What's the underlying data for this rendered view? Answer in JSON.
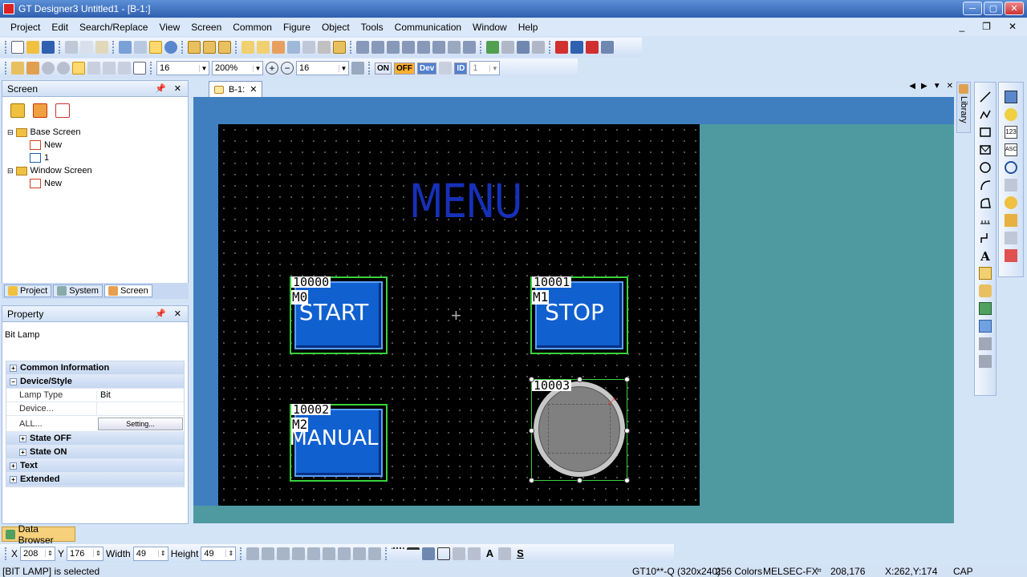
{
  "window": {
    "title": "GT Designer3 Untitled1 - [B-1:]",
    "min": "─",
    "max": "▢",
    "close": "✕"
  },
  "menu": [
    "Project",
    "Edit",
    "Search/Replace",
    "View",
    "Screen",
    "Common",
    "Figure",
    "Object",
    "Tools",
    "Communication",
    "Window",
    "Help"
  ],
  "toolbar2": {
    "grid_value": "16",
    "zoom": "200%",
    "snap_value": "16",
    "on_label": "ON",
    "off_label": "OFF",
    "dev_label": "Dev",
    "id_label": "ID",
    "page_value": "1"
  },
  "screen_panel": {
    "title": "Screen",
    "tree": [
      {
        "label": "Base Screen",
        "level": 0,
        "type": "folder"
      },
      {
        "label": "New",
        "level": 1,
        "type": "new"
      },
      {
        "label": "1",
        "level": 1,
        "type": "screen"
      },
      {
        "label": "Window Screen",
        "level": 0,
        "type": "folder"
      },
      {
        "label": "New",
        "level": 1,
        "type": "new"
      }
    ],
    "tabs": [
      "Project",
      "System",
      "Screen"
    ]
  },
  "property_panel": {
    "title": "Property",
    "object": "Bit Lamp",
    "rows": [
      {
        "label": "Common Information",
        "cat": true,
        "sign": "+"
      },
      {
        "label": "Device/Style",
        "cat": true,
        "sign": "−"
      },
      {
        "label": "Lamp Type",
        "value": "Bit"
      },
      {
        "label": "Device...",
        "value": ""
      },
      {
        "label": "ALL...",
        "button": "Setting..."
      },
      {
        "label": "State OFF",
        "cat": true,
        "sign": "+",
        "sub": true
      },
      {
        "label": "State ON",
        "cat": true,
        "sign": "+",
        "sub": true
      },
      {
        "label": "Text",
        "cat": true,
        "sign": "+"
      },
      {
        "label": "Extended",
        "cat": true,
        "sign": "+"
      }
    ]
  },
  "doc_tab": {
    "label": "B-1:",
    "close": "✕"
  },
  "library_label": "Library",
  "canvas": {
    "title": "MENU",
    "buttons": [
      {
        "id": "10000",
        "device": "M0",
        "label": "START"
      },
      {
        "id": "10001",
        "device": "M1",
        "label": "STOP"
      },
      {
        "id": "10002",
        "device": "M2",
        "label": "MANUAL"
      }
    ],
    "lamp": {
      "id": "10003"
    }
  },
  "data_browser": "Data Browser",
  "coords": {
    "x_label": "X",
    "x": "208",
    "y_label": "Y",
    "y": "176",
    "w_label": "Width",
    "w": "49",
    "h_label": "Height",
    "h": "49"
  },
  "status": {
    "message": "[BIT LAMP] is selected",
    "model": "GT10**-Q (320x240)",
    "colors": "256 Colors",
    "plc": "MELSEC-FX",
    "pos": "208,176",
    "cursor": "X:262,Y:174",
    "cap": "CAP"
  }
}
